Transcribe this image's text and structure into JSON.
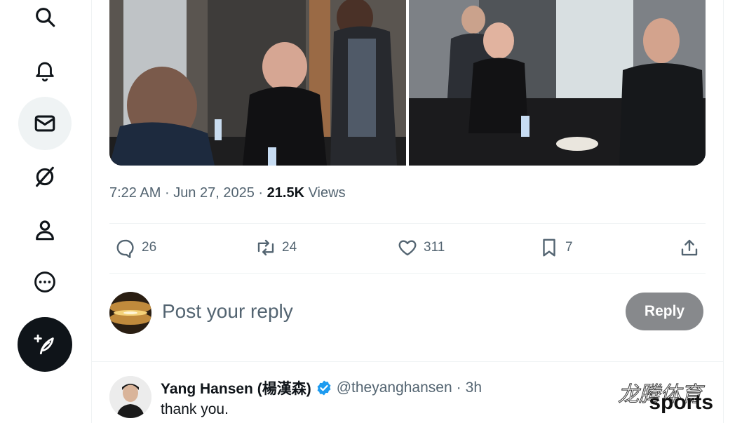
{
  "nav": {
    "items": [
      {
        "name": "search",
        "icon": "search-icon"
      },
      {
        "name": "notifications",
        "icon": "bell-icon"
      },
      {
        "name": "messages",
        "icon": "mail-icon",
        "active": true
      },
      {
        "name": "grok",
        "icon": "slash-circle-icon"
      },
      {
        "name": "profile",
        "icon": "person-icon"
      },
      {
        "name": "more",
        "icon": "more-circle-icon"
      }
    ],
    "compose_icon": "feather-plus-icon"
  },
  "post": {
    "media": [
      {
        "description": "bald man on phone signing papers at meeting table while another man stands beside him"
      },
      {
        "description": "people applauding around a conference table"
      }
    ],
    "time": "7:22 AM",
    "separator": "·",
    "date": "Jun 27, 2025",
    "views_count": "21.5K",
    "views_label": "Views",
    "stats": {
      "replies": "26",
      "reposts": "24",
      "likes": "311",
      "bookmarks": "7"
    }
  },
  "reply_box": {
    "placeholder": "Post your reply",
    "button": "Reply"
  },
  "comment": {
    "name": "Yang Hansen (楊漢森)",
    "handle": "@theyanghansen",
    "separator": "·",
    "time": "3h",
    "text": "thank you."
  },
  "watermark": {
    "cn": "龙腾体育",
    "en": "sports"
  },
  "colors": {
    "text": "#0f1419",
    "muted": "#536471",
    "border": "#eff3f4",
    "verified": "#1d9bf0",
    "reply_button": "#87898c"
  }
}
